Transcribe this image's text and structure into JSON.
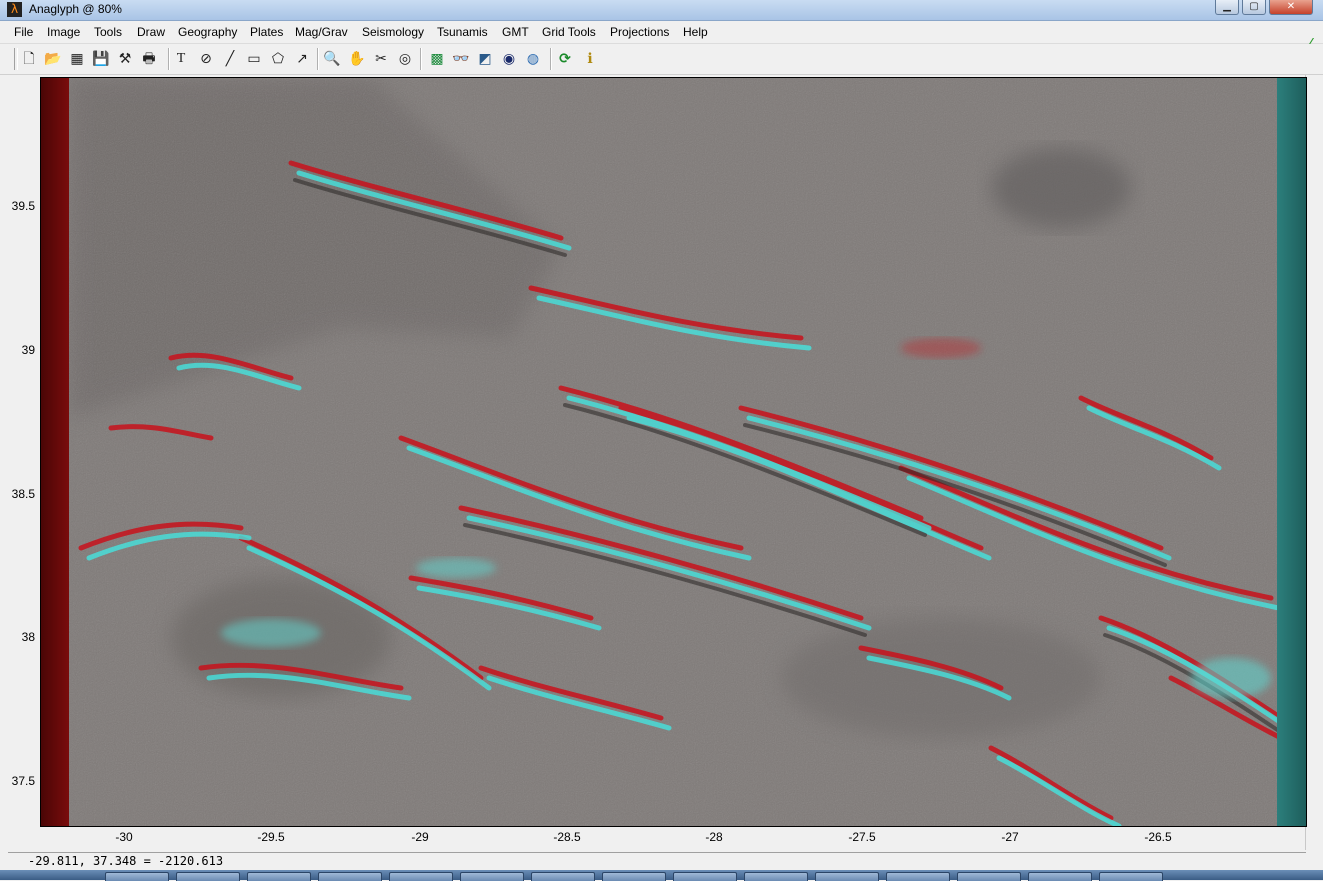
{
  "window": {
    "title": "Anaglyph  @  80%",
    "buttons": {
      "minimize": "▁",
      "maximize": "▢",
      "close": "✕"
    }
  },
  "menu": [
    "File",
    "Image",
    "Tools",
    "Draw",
    "Geography",
    "Plates",
    "Mag/Grav",
    "Seismology",
    "Tsunamis",
    "GMT",
    "Grid Tools",
    "Projections",
    "Help"
  ],
  "toolbar": {
    "groups": [
      [
        {
          "name": "new-file-icon",
          "glyph": "🗋"
        },
        {
          "name": "open-folder-icon",
          "glyph": "📂"
        },
        {
          "name": "image-icon",
          "glyph": "▦"
        },
        {
          "name": "save-icon",
          "glyph": "💾"
        },
        {
          "name": "tools-icon",
          "glyph": "⚒"
        },
        {
          "name": "print-icon",
          "glyph": "🖶"
        }
      ],
      [
        {
          "name": "text-icon",
          "glyph": "T"
        },
        {
          "name": "compass-icon",
          "glyph": "⊘"
        },
        {
          "name": "line-icon",
          "glyph": "╱"
        },
        {
          "name": "rectangle-icon",
          "glyph": "▭"
        },
        {
          "name": "polygon-icon",
          "glyph": "⬠"
        },
        {
          "name": "arrow-icon",
          "glyph": "↗"
        }
      ],
      [
        {
          "name": "zoom-icon",
          "glyph": "🔍"
        },
        {
          "name": "pan-hand-icon",
          "glyph": "✋"
        },
        {
          "name": "scissors-icon",
          "glyph": "✂"
        },
        {
          "name": "datum-icon",
          "glyph": "◎"
        }
      ],
      [
        {
          "name": "shading-icon",
          "glyph": "▩"
        },
        {
          "name": "anaglyph-glasses-icon",
          "glyph": "👓"
        },
        {
          "name": "terrain-icon",
          "glyph": "◩"
        },
        {
          "name": "globe-dark-icon",
          "glyph": "◉"
        },
        {
          "name": "globe-icon",
          "glyph": "◍"
        }
      ],
      [
        {
          "name": "refresh-icon",
          "glyph": "⟳"
        },
        {
          "name": "info-icon",
          "glyph": "ℹ"
        }
      ]
    ]
  },
  "axes": {
    "x_ticks": [
      "-30",
      "-29.5",
      "-29",
      "-28.5",
      "-28",
      "-27.5",
      "-27",
      "-26.5"
    ],
    "y_ticks": [
      "39.5",
      "39",
      "38.5",
      "38",
      "37.5"
    ]
  },
  "status": {
    "coordinates": "-29.811, 37.348 = -2120.613"
  },
  "colors": {
    "anaglyph_red": "#d0101a",
    "anaglyph_cyan": "#3ee0dc",
    "terrain_gray": "#807b79"
  }
}
